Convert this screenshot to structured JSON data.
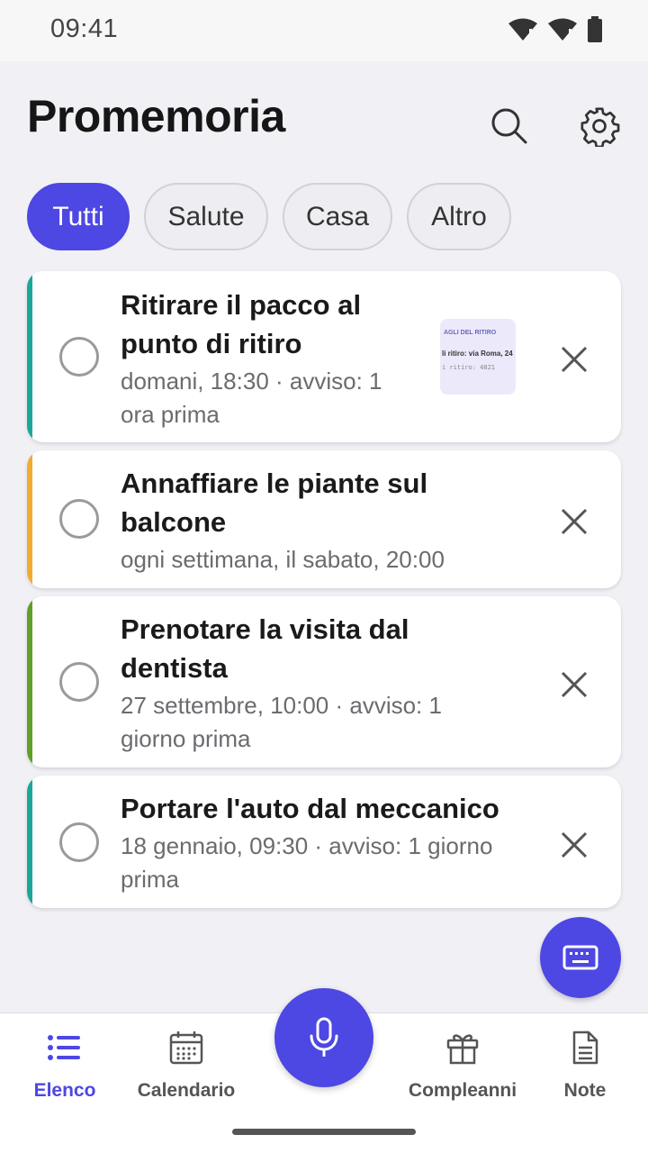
{
  "status": {
    "time": "09:41"
  },
  "header": {
    "title": "Promemoria"
  },
  "filters": [
    {
      "label": "Tutti",
      "active": true
    },
    {
      "label": "Salute",
      "active": false
    },
    {
      "label": "Casa",
      "active": false
    },
    {
      "label": "Altro",
      "active": false
    }
  ],
  "reminders": [
    {
      "title_lines": [
        "Ritirare il pacco al",
        "punto di ritiro"
      ],
      "sub_lines": [
        "domani, 18:30 · avviso: 1",
        "ora prima"
      ],
      "accent": "#1aa79a",
      "thumbnail": {
        "line1": "AGLI DEL RITIRO",
        "line2": "li ritiro: via Roma, 24",
        "line3": "i ritiro: 4821"
      }
    },
    {
      "title_lines": [
        "Annaffiare le piante sul",
        "balcone"
      ],
      "sub_lines": [
        "ogni settimana, il sabato, 20:00"
      ],
      "accent": "#f2aa33"
    },
    {
      "title_lines": [
        "Prenotare la visita dal",
        "dentista"
      ],
      "sub_lines": [
        "27 settembre, 10:00 · avviso: 1",
        "giorno prima"
      ],
      "accent": "#5ea02a"
    },
    {
      "title_lines": [
        "Portare l'auto dal meccanico"
      ],
      "sub_lines": [
        "18 gennaio, 09:30 · avviso: 1 giorno",
        "prima"
      ],
      "accent": "#1aa79a"
    }
  ],
  "nav": [
    {
      "label": "Elenco",
      "icon": "list-icon",
      "active": true
    },
    {
      "label": "Calendario",
      "icon": "calendar-icon",
      "active": false
    },
    {
      "label": "Compleanni",
      "icon": "gift-icon",
      "active": false
    },
    {
      "label": "Note",
      "icon": "note-icon",
      "active": false
    }
  ],
  "colors": {
    "primary": "#4d47e3",
    "background": "#f1f0f5"
  }
}
